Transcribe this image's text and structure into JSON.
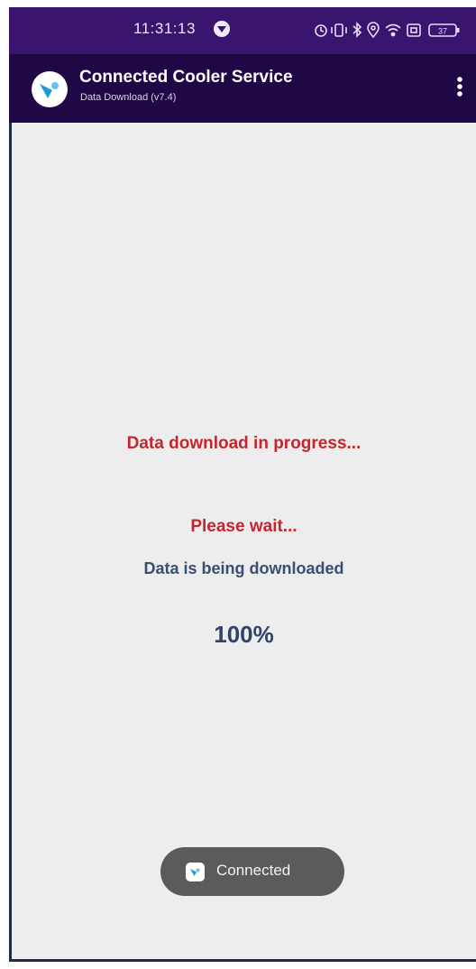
{
  "status_bar": {
    "time": "11:31:13",
    "battery_level": "37"
  },
  "app_bar": {
    "title": "Connected Cooler Service",
    "subtitle": "Data Download (v7.4)"
  },
  "content": {
    "progress_message": "Data download in progress...",
    "wait_message": "Please wait...",
    "status_message": "Data is being downloaded",
    "percent": "100%"
  },
  "toast": {
    "text": "Connected"
  },
  "colors": {
    "status_bar_bg": "#3a1570",
    "app_bar_bg": "#200846",
    "alert_red": "#c6252b",
    "info_blue": "#3a4e73"
  }
}
